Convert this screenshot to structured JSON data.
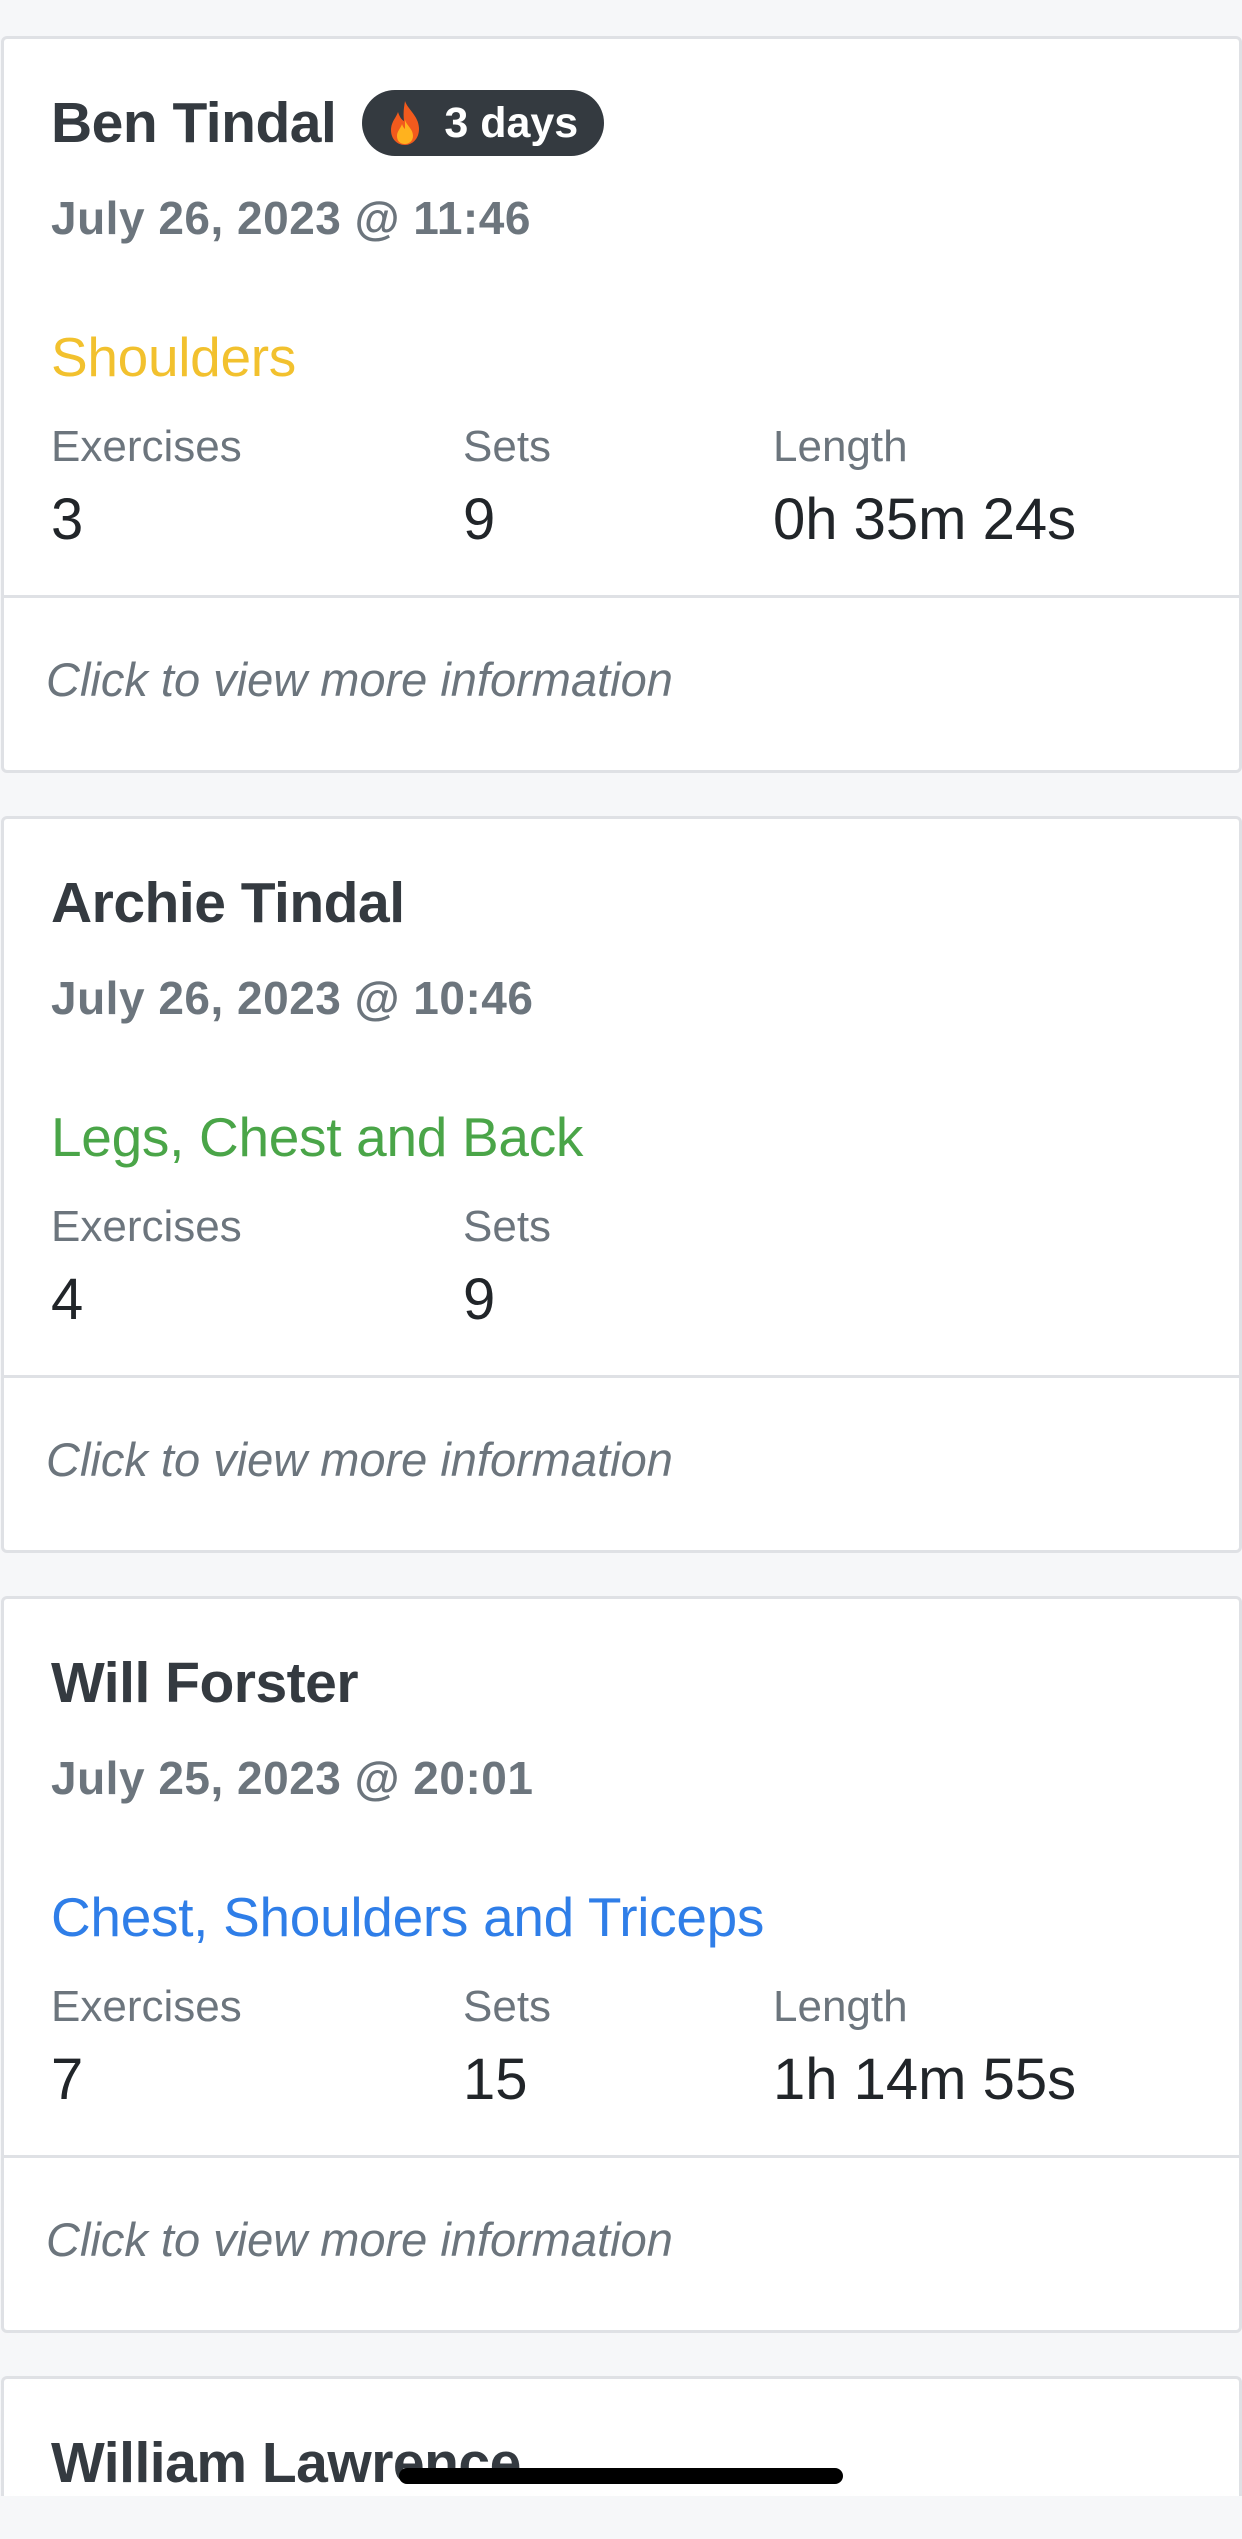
{
  "workouts": [
    {
      "name": "Ben Tindal",
      "streak": "3 days",
      "date": "July 26, 2023 @ 11:46",
      "muscles": "Shoulders",
      "muscles_color": "#f2c12e",
      "exercises_label": "Exercises",
      "exercises": "3",
      "sets_label": "Sets",
      "sets": "9",
      "length_label": "Length",
      "length": "0h 35m 24s",
      "footer": "Click to view more information"
    },
    {
      "name": "Archie Tindal",
      "date": "July 26, 2023 @ 10:46",
      "muscles": "Legs, Chest and Back",
      "muscles_color": "#4aa548",
      "exercises_label": "Exercises",
      "exercises": "4",
      "sets_label": "Sets",
      "sets": "9",
      "footer": "Click to view more information"
    },
    {
      "name": "Will Forster",
      "date": "July 25, 2023 @ 20:01",
      "muscles": "Chest, Shoulders and Triceps",
      "muscles_color": "#2f7ee8",
      "exercises_label": "Exercises",
      "exercises": "7",
      "sets_label": "Sets",
      "sets": "15",
      "length_label": "Length",
      "length": "1h 14m 55s",
      "footer": "Click to view more information"
    },
    {
      "name": "William Lawrence"
    }
  ],
  "icons": {
    "streak": "flame-icon"
  }
}
